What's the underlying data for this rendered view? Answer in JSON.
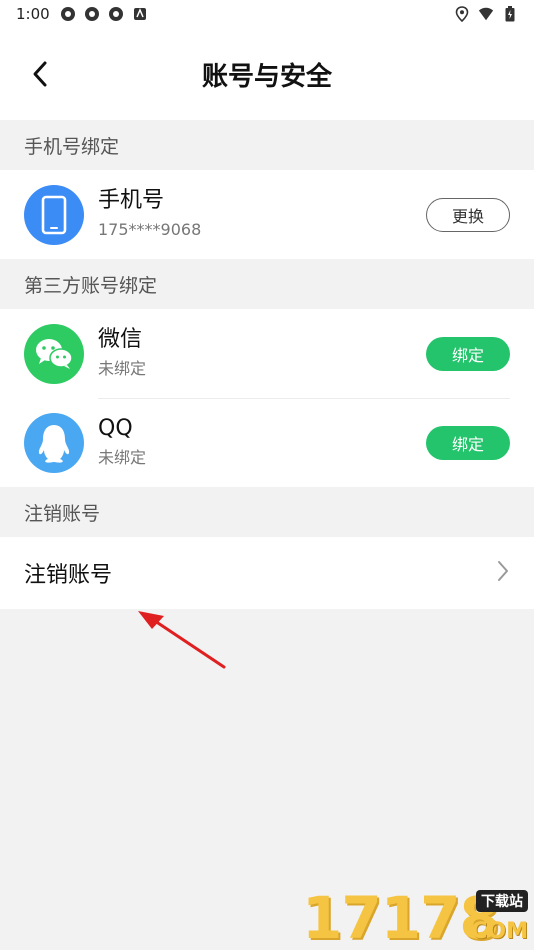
{
  "status_bar": {
    "time": "1:00",
    "left_icons": [
      "settings-icon",
      "settings-icon",
      "settings-icon",
      "app-icon"
    ],
    "right_icons": [
      "location-icon",
      "wifi-icon",
      "battery-icon"
    ]
  },
  "header": {
    "title": "账号与安全",
    "back_icon": "chevron-left-icon"
  },
  "sections": {
    "phone_binding": {
      "label": "手机号绑定",
      "item": {
        "name": "手机号",
        "value": "175****9068",
        "button": "更换"
      }
    },
    "third_party": {
      "label": "第三方账号绑定",
      "items": [
        {
          "name": "微信",
          "status": "未绑定",
          "button": "绑定"
        },
        {
          "name": "QQ",
          "status": "未绑定",
          "button": "绑定"
        }
      ]
    },
    "cancel_account": {
      "label": "注销账号",
      "item": {
        "name": "注销账号"
      }
    }
  },
  "watermark": {
    "number": "17178",
    "tag": "下载站",
    "suffix": "COM"
  },
  "colors": {
    "bind_green": "#23c46b",
    "phone_blue": "#3b8cf5",
    "wechat_green": "#2ecb63",
    "qq_blue": "#4aa8f2",
    "annotation_red": "#e02020"
  }
}
